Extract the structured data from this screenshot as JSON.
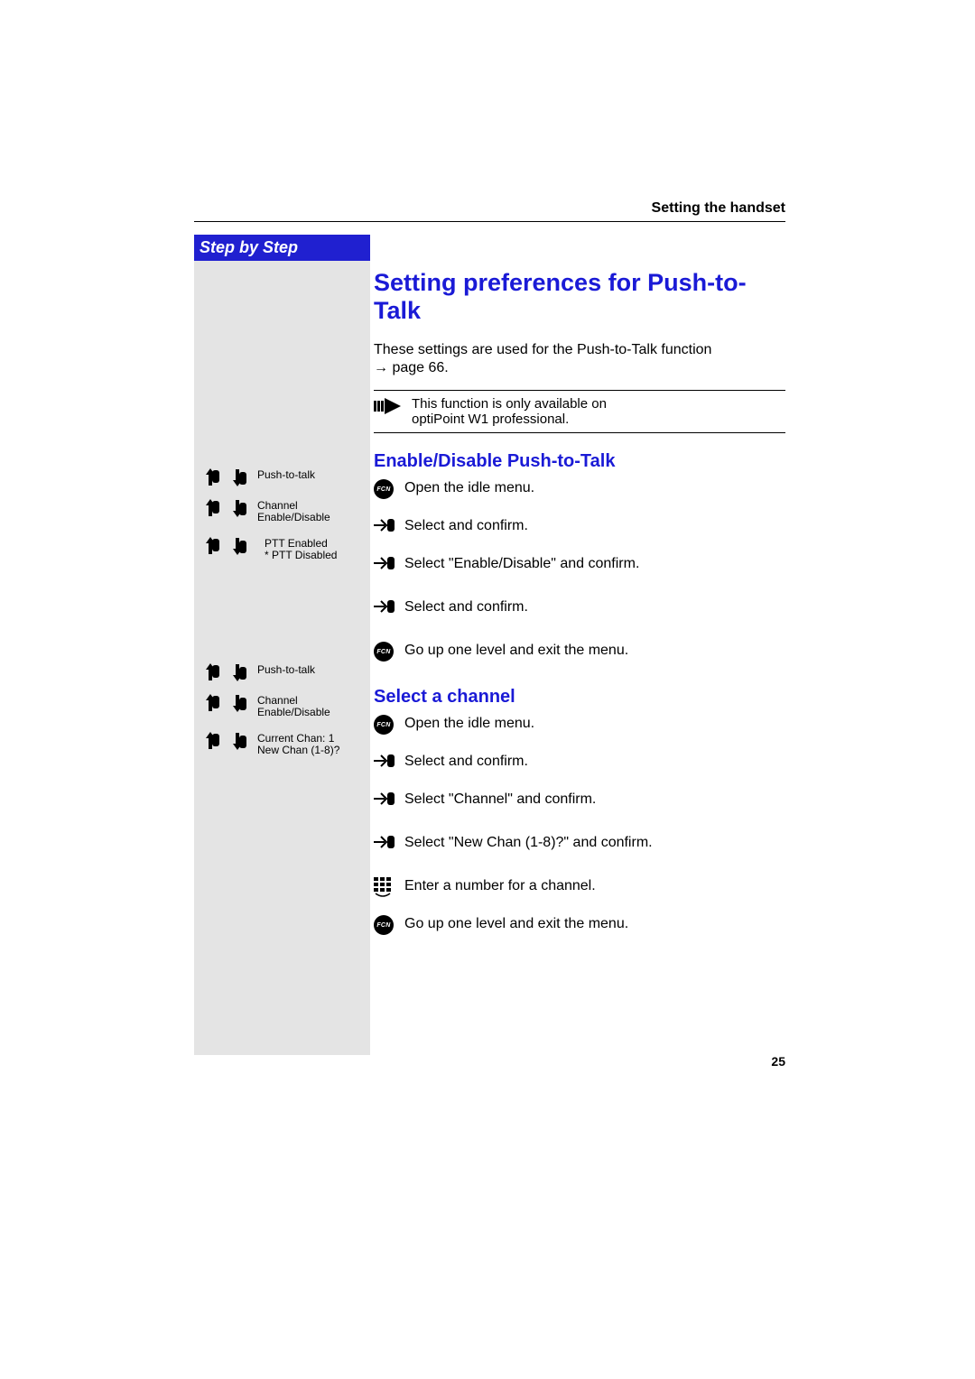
{
  "header": "Setting the handset",
  "sidebar_title": "Step by Step",
  "title": "Setting preferences for Push-to-Talk",
  "intro_line1": "These settings are used for the Push-to-Talk function",
  "intro_line2": "→ page 66.",
  "note_line1": "This function is only available on",
  "note_line2": "optiPoint W1 professional.",
  "fcn_label": "FCN",
  "section1": {
    "heading": "Enable/Disable Push-to-Talk",
    "steps": {
      "s1": "Open the idle menu.",
      "s2": "Select and confirm.",
      "s3": "Select \"Enable/Disable\" and confirm.",
      "s4": "Select and confirm.",
      "s5": "Go up one level and exit the menu."
    },
    "side": {
      "e1": "Push-to-talk",
      "e2a": "Channel",
      "e2b": "Enable/Disable",
      "e3a": "PTT Enabled",
      "e3b": "* PTT Disabled"
    }
  },
  "section2": {
    "heading": "Select a channel",
    "steps": {
      "s1": "Open the idle menu.",
      "s2": "Select and confirm.",
      "s3": "Select \"Channel\" and confirm.",
      "s4": "Select \"New Chan (1-8)?\" and confirm.",
      "s5": "Enter a number for a channel.",
      "s6": "Go up one level and exit the menu."
    },
    "side": {
      "e1": "Push-to-talk",
      "e2a": "Channel",
      "e2b": "Enable/Disable",
      "e3a": "Current Chan: 1",
      "e3b": "New Chan (1-8)?"
    }
  },
  "page_number": "25"
}
